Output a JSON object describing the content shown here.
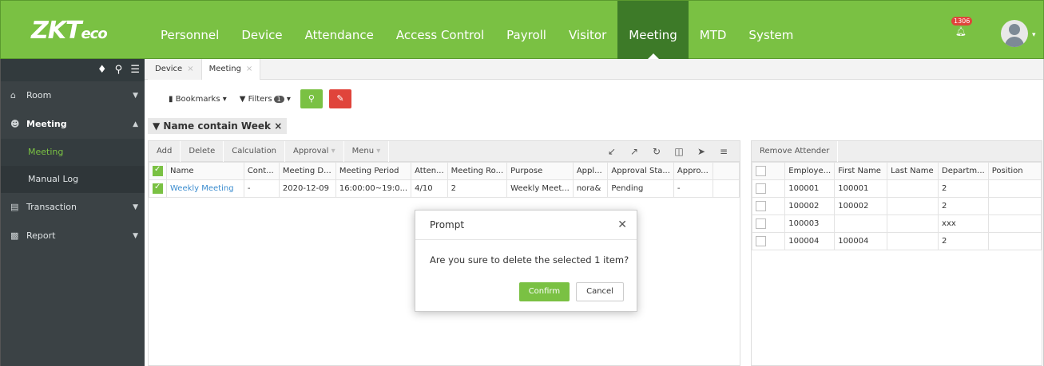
{
  "logo": {
    "text": "ZKTeco"
  },
  "nav": {
    "items": [
      "Personnel",
      "Device",
      "Attendance",
      "Access Control",
      "Payroll",
      "Visitor",
      "Meeting",
      "MTD",
      "System"
    ],
    "active": "Meeting"
  },
  "notification": {
    "count": "1306",
    "icon": "bell-icon"
  },
  "user": {
    "icon": "user-avatar-icon"
  },
  "sidebar": {
    "tools": [
      "tag-icon",
      "search-icon",
      "list-icon"
    ],
    "items": [
      {
        "label": "Room",
        "icon": "home-icon"
      },
      {
        "label": "Meeting",
        "icon": "people-icon"
      },
      {
        "label": "Meeting"
      },
      {
        "label": "Manual Log"
      },
      {
        "label": "Transaction",
        "icon": "database-icon"
      },
      {
        "label": "Report",
        "icon": "report-icon"
      }
    ]
  },
  "tabs": [
    {
      "label": "Device"
    },
    {
      "label": "Meeting"
    }
  ],
  "toolbar": {
    "bookmarks": "Bookmarks",
    "filters": "Filters",
    "filter_count": "1"
  },
  "filter_chip": "Name contain Week",
  "left_grid": {
    "buttons": [
      "Add",
      "Delete",
      "Calculation",
      "Approval",
      "Menu"
    ],
    "columns": [
      "Name",
      "Cont...",
      "Meeting D...",
      "Meeting Period",
      "Atten...",
      "Meeting Ro...",
      "Purpose",
      "Appl...",
      "Approval Sta...",
      "Appro..."
    ],
    "rows": [
      [
        "Weekly Meeting",
        "-",
        "2020-12-09",
        "16:00:00~19:0...",
        "4/10",
        "2",
        "Weekly Meet...",
        "nora&",
        "Pending",
        "-"
      ]
    ]
  },
  "right_grid": {
    "button": "Remove Attender",
    "columns": [
      "Employe...",
      "First Name",
      "Last Name",
      "Departm...",
      "Position"
    ],
    "rows": [
      [
        "100001",
        "100001",
        "",
        "2",
        ""
      ],
      [
        "100002",
        "100002",
        "",
        "2",
        ""
      ],
      [
        "100003",
        "",
        "",
        "xxx",
        ""
      ],
      [
        "100004",
        "100004",
        "",
        "2",
        ""
      ]
    ]
  },
  "dialog": {
    "title": "Prompt",
    "message": "Are you sure to delete the selected 1 item?",
    "confirm": "Confirm",
    "cancel": "Cancel"
  },
  "colors": {
    "brand": "#7ac143",
    "nav_active": "#3d7a28",
    "danger": "#e0443b",
    "sidebar": "#3b4245"
  }
}
